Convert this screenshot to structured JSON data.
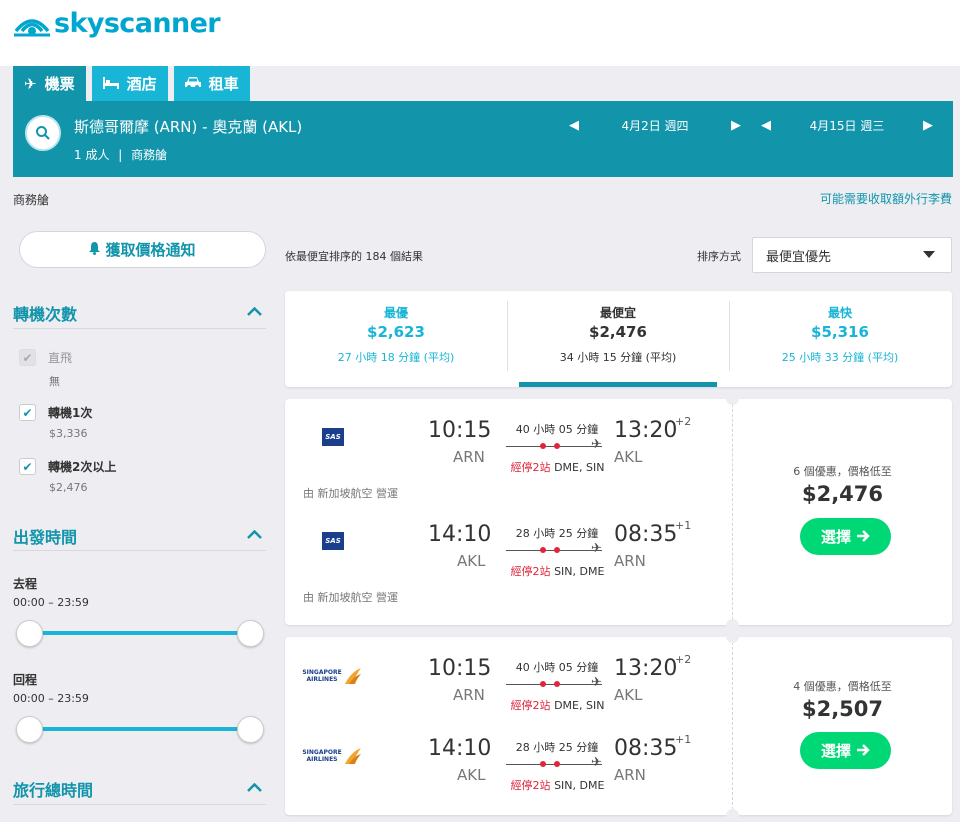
{
  "header": {
    "logo_text": "skyscanner"
  },
  "tabs": [
    {
      "label": "機票",
      "icon": "plane-icon"
    },
    {
      "label": "酒店",
      "icon": "bed-icon"
    },
    {
      "label": "租車",
      "icon": "car-icon"
    }
  ],
  "search": {
    "route": "斯德哥爾摩 (ARN) - 奧克蘭 (AKL)",
    "passengers": "1 成人",
    "cabin": "商務艙",
    "depart_date": "4月2日 週四",
    "return_date": "4月15日 週三"
  },
  "subheader": {
    "cabin": "商務艙",
    "baggage_note": "可能需要收取額外行李費"
  },
  "sidebar": {
    "alert_button": "獲取價格通知",
    "stops": {
      "title": "轉機次數",
      "options": [
        {
          "label": "直飛",
          "price": "無",
          "checked": true,
          "disabled": true
        },
        {
          "label": "轉機1次",
          "price": "$3,336",
          "checked": true,
          "disabled": false
        },
        {
          "label": "轉機2次以上",
          "price": "$2,476",
          "checked": true,
          "disabled": false
        }
      ]
    },
    "departure_times": {
      "title": "出發時間",
      "outbound": {
        "label": "去程",
        "range": "00:00 – 23:59"
      },
      "inbound": {
        "label": "回程",
        "range": "00:00 – 23:59"
      }
    },
    "journey_duration": {
      "title": "旅行總時間"
    }
  },
  "results": {
    "summary_text": "依最便宜排序的 184 個結果",
    "sort_label": "排序方式",
    "sort_value": "最便宜優先"
  },
  "summary": [
    {
      "label": "最優",
      "price": "$2,623",
      "time": "27 小時 18 分鐘 (平均)",
      "active": false
    },
    {
      "label": "最便宜",
      "price": "$2,476",
      "time": "34 小時 15 分鐘 (平均)",
      "active": true
    },
    {
      "label": "最快",
      "price": "$5,316",
      "time": "25 小時 33 分鐘 (平均)",
      "active": false
    }
  ],
  "itineraries": [
    {
      "legs": [
        {
          "airline": "SAS",
          "dep_time": "10:15",
          "dep_code": "ARN",
          "arr_time": "13:20",
          "arr_code": "AKL",
          "day_offset": "+2",
          "duration": "40 小時 05 分鐘",
          "stops_label": "經停2站",
          "stops_airports": "DME, SIN",
          "operated": "由 新加坡航空 營運"
        },
        {
          "airline": "SAS",
          "dep_time": "14:10",
          "dep_code": "AKL",
          "arr_time": "08:35",
          "arr_code": "ARN",
          "day_offset": "+1",
          "duration": "28 小時 25 分鐘",
          "stops_label": "經停2站",
          "stops_airports": "SIN, DME",
          "operated": "由 新加坡航空 營運"
        }
      ],
      "deals": "6 個優惠，價格低至",
      "price": "$2,476",
      "select_label": "選擇"
    },
    {
      "legs": [
        {
          "airline": "SINGAPORE AIRLINES",
          "dep_time": "10:15",
          "dep_code": "ARN",
          "arr_time": "13:20",
          "arr_code": "AKL",
          "day_offset": "+2",
          "duration": "40 小時 05 分鐘",
          "stops_label": "經停2站",
          "stops_airports": "DME, SIN"
        },
        {
          "airline": "SINGAPORE AIRLINES",
          "dep_time": "14:10",
          "dep_code": "AKL",
          "arr_time": "08:35",
          "arr_code": "ARN",
          "day_offset": "+1",
          "duration": "28 小時 25 分鐘",
          "stops_label": "經停2站",
          "stops_airports": "SIN, DME"
        }
      ],
      "deals": "4 個優惠，價格低至",
      "price": "$2,507",
      "select_label": "選擇"
    }
  ],
  "colors": {
    "brand": "#00a6cf",
    "bar": "#1295ab",
    "tab": "#19b5d6",
    "cta": "#00d775",
    "stop_red": "#e0263a"
  }
}
